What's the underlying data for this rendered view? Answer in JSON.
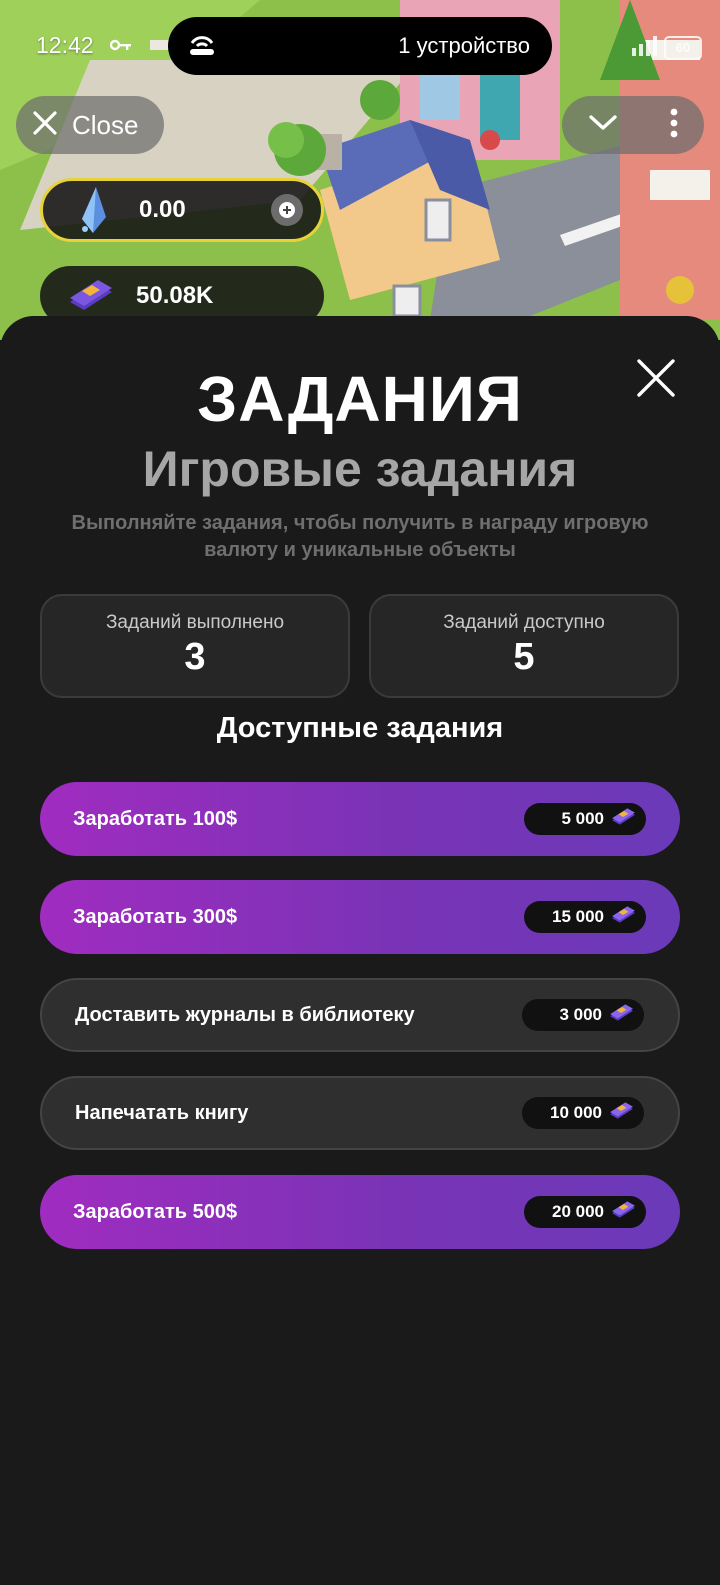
{
  "status_bar": {
    "time": "12:42",
    "device_pill": "1 устройство",
    "battery": "60"
  },
  "top_bar": {
    "close_label": "Close"
  },
  "balances": {
    "crystals": "0.00",
    "cash": "50.08K"
  },
  "modal": {
    "title": "ЗАДАНИЯ",
    "subtitle": "Игровые задания",
    "description": "Выполняйте задания, чтобы получить в награду игровую валюту и уникальные объекты",
    "stats": {
      "completed_label": "Заданий выполнено",
      "completed_value": "3",
      "available_label": "Заданий доступно",
      "available_value": "5"
    },
    "section_title": "Доступные задания",
    "tasks": [
      {
        "label": "Заработать 100$",
        "reward": "5 000"
      },
      {
        "label": "Заработать 300$",
        "reward": "15 000"
      },
      {
        "label": "Доставить журналы в библиотеку",
        "reward": "3 000"
      },
      {
        "label": "Напечатать книгу",
        "reward": "10 000"
      },
      {
        "label": "Заработать 500$",
        "reward": "20 000"
      }
    ]
  },
  "colors": {
    "accent_purple": "#a02cc0",
    "sheet_bg": "#1a1a1b",
    "crystal_border": "#e8d23a"
  }
}
